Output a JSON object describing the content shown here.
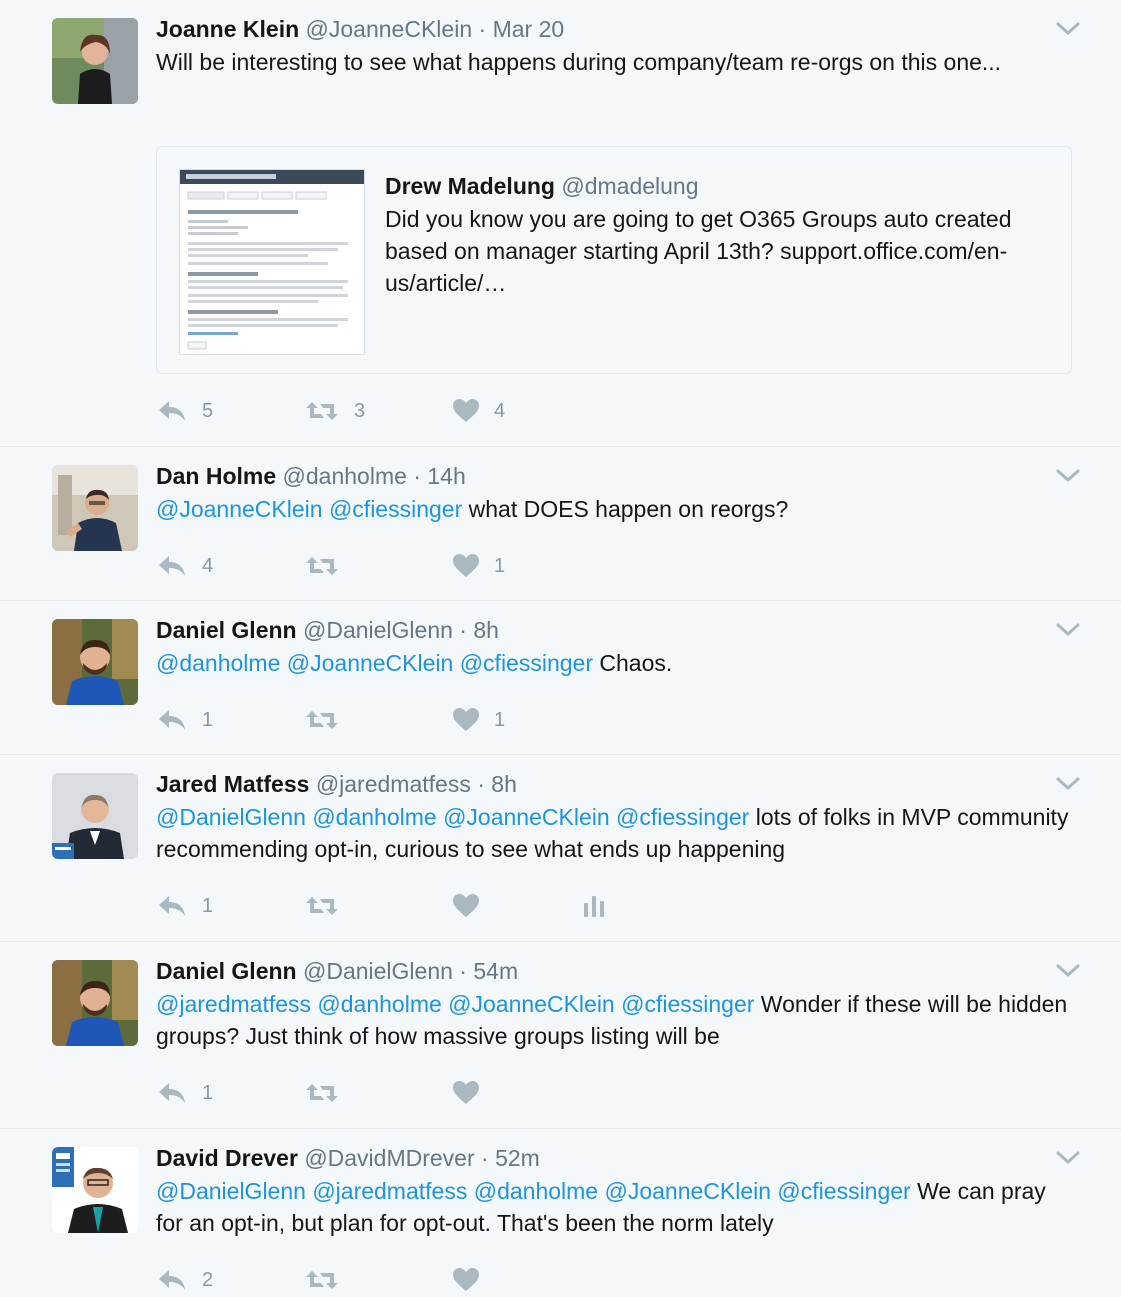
{
  "tweets": [
    {
      "name": "Joanne Klein",
      "handle": "@JoanneCKlein",
      "time": "Mar 20",
      "text": "Will be interesting to see what happens during company/team re-orgs on this one...",
      "quote": {
        "name": "Drew Madelung",
        "handle": "@dmadelung",
        "text": "Did you know you are going to get O365 Groups auto created based on manager starting April 13th? support.office.com/en-us/article/…"
      },
      "replies": "5",
      "retweets": "3",
      "likes": "4"
    },
    {
      "name": "Dan Holme",
      "handle": "@danholme",
      "time": "14h",
      "mentions": "@JoanneCKlein @cfiessinger",
      "text": " what DOES happen on reorgs?",
      "replies": "4",
      "likes": "1"
    },
    {
      "name": "Daniel Glenn",
      "handle": "@DanielGlenn",
      "time": "8h",
      "mentions": "@danholme @JoanneCKlein @cfiessinger",
      "text": " Chaos.",
      "replies": "1",
      "likes": "1"
    },
    {
      "name": "Jared Matfess",
      "handle": "@jaredmatfess",
      "time": "8h",
      "mentions": "@DanielGlenn @danholme @JoanneCKlein @cfiessinger",
      "text": " lots of folks in MVP community recommending opt-in, curious to see what ends up happening",
      "replies": "1"
    },
    {
      "name": "Daniel Glenn",
      "handle": "@DanielGlenn",
      "time": "54m",
      "mentions": "@jaredmatfess @danholme @JoanneCKlein @cfiessinger",
      "text": " Wonder if these will be hidden groups? Just think of how massive groups listing will be",
      "replies": "1"
    },
    {
      "name": "David Drever",
      "handle": "@DavidMDrever",
      "time": "52m",
      "mentions": "@DanielGlenn @jaredmatfess @danholme @JoanneCKlein @cfiessinger",
      "text": " We can pray for an opt-in, but plan for opt-out. That's been the norm lately",
      "replies": "2"
    }
  ],
  "separator": " · ",
  "icons": {
    "reply": "reply-icon",
    "retweet": "retweet-icon",
    "like": "heart-icon",
    "analytics": "analytics-icon",
    "more": "chevron-down-icon"
  },
  "colors": {
    "mention": "#1b95e0",
    "muted": "#657786",
    "action": "#aab8c2",
    "background": "#f5f8fa"
  }
}
